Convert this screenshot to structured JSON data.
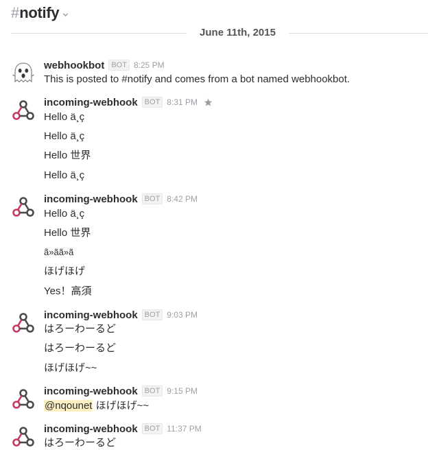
{
  "channel": {
    "hash": "#",
    "name": "notify"
  },
  "day_divider": {
    "label": "June 11th, 2015"
  },
  "icons": {
    "chevron": "chevron-down-icon",
    "ghost_avatar": "ghost-icon",
    "webhook_avatar": "webhook-icon",
    "star": "star-icon"
  },
  "colors": {
    "webhook_pink": "#c73a63",
    "webhook_dark": "#4b4b4b",
    "mention_highlight": "#fdf0c2"
  },
  "messages": [
    {
      "sender": "webhookbot",
      "badge": "BOT",
      "time": "8:25 PM",
      "lines": [
        "This is posted to #notify and comes from a bot named webhookbot."
      ]
    },
    {
      "sender": "incoming-webhook",
      "badge": "BOT",
      "time": "8:31 PM",
      "lines": [
        "Hello ä¸ç",
        "Hello ä¸ç",
        "Hello 世界",
        "Hello ä¸ç"
      ]
    },
    {
      "sender": "incoming-webhook",
      "badge": "BOT",
      "time": "8:42 PM",
      "lines": [
        "Hello ä¸ç",
        "Hello 世界",
        "ã»ãã»ã",
        "ほげほげ",
        "Yes！高須"
      ]
    },
    {
      "sender": "incoming-webhook",
      "badge": "BOT",
      "time": "9:03 PM",
      "lines": [
        "はろーわーるど",
        "はろーわーるど",
        "ほげほげ~~"
      ]
    },
    {
      "sender": "incoming-webhook",
      "badge": "BOT",
      "time": "9:15 PM",
      "mention": "@nqounet",
      "lines": [
        " ほげほげ~~"
      ]
    },
    {
      "sender": "incoming-webhook",
      "badge": "BOT",
      "time": "11:37 PM",
      "lines": [
        "はろーわーるど"
      ]
    }
  ]
}
